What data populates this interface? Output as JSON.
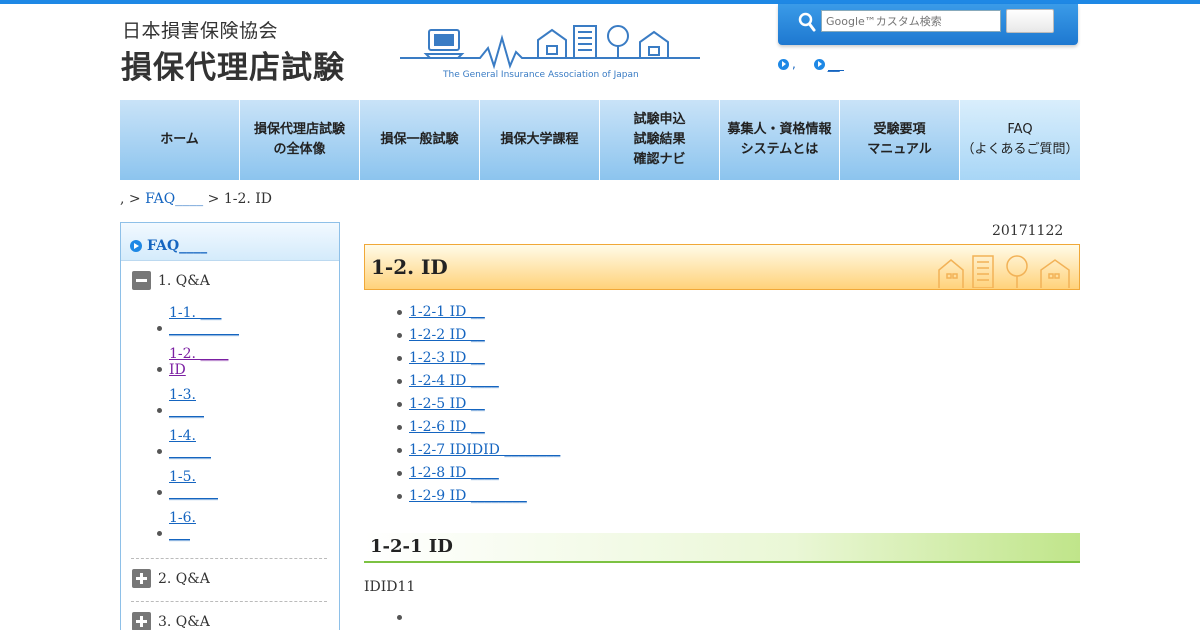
{
  "header": {
    "association": "日本損害保険協会",
    "title": "損保代理店試験",
    "tagline": "The General Insurance Association of Japan"
  },
  "search": {
    "placeholder": "Google™カスタム検索",
    "button_label": "",
    "icon": "search-icon"
  },
  "util_links": [
    {
      "label": ","
    },
    {
      "label": "__"
    }
  ],
  "nav": [
    {
      "label": "ホーム"
    },
    {
      "label": "損保代理店試験\nの全体像"
    },
    {
      "label": "損保一般試験"
    },
    {
      "label": "損保大学課程"
    },
    {
      "label": "試験申込\n試験結果\n確認ナビ"
    },
    {
      "label": "募集人・資格情報\nシステムとは"
    },
    {
      "label": "受験要項\nマニュアル"
    },
    {
      "label": "FAQ\n（よくあるご質問）"
    }
  ],
  "breadcrumb": {
    "prefix": ",",
    "sep1": " > ",
    "link": "FAQ____",
    "sep2": " > ",
    "current": "1-2. ID"
  },
  "sidebar": {
    "head": "FAQ____",
    "cat1": "1. Q&A",
    "items": [
      {
        "label": "1-1. ___\n__________"
      },
      {
        "label": "1-2. ____\nID"
      },
      {
        "label": "1-3.\n_____"
      },
      {
        "label": "1-4.\n______"
      },
      {
        "label": "1-5.\n_______"
      },
      {
        "label": "1-6.\n___"
      }
    ],
    "cat2": "2. Q&A",
    "cat3": "3. Q&A"
  },
  "main": {
    "date": "20171122",
    "title": "1-2. ID",
    "toc": [
      {
        "label": "1-2-1 ID __"
      },
      {
        "label": "1-2-2 ID __"
      },
      {
        "label": "1-2-3 ID __"
      },
      {
        "label": "1-2-4 ID ____"
      },
      {
        "label": "1-2-5 ID __"
      },
      {
        "label": "1-2-6 ID __"
      },
      {
        "label": "1-2-7 IDIDID ________"
      },
      {
        "label": "1-2-8 ID ____"
      },
      {
        "label": "1-2-9 ID ________"
      }
    ],
    "section_title": "1-2-1 ID",
    "section_text": "IDID11"
  },
  "colors": {
    "accent": "#1e88e5",
    "link": "#1565c0",
    "visited": "#7b1fa2",
    "title_border": "#f0a838",
    "section_green": "#7cc242"
  }
}
